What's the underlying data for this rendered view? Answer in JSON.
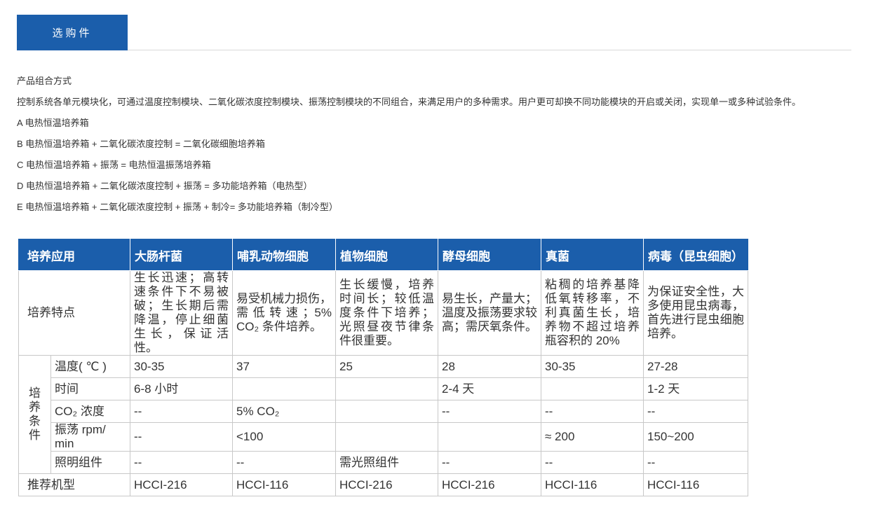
{
  "tab": {
    "label": "选购件"
  },
  "description": {
    "heading": "产品组合方式",
    "paragraph": "控制系统各单元模块化，可通过温度控制模块、二氧化碳浓度控制模块、振荡控制模块的不同组合，来满足用户的多种需求。用户更可却换不同功能模块的开启或关闭，实现单一或多种试验条件。",
    "combos": [
      "A 电热恒温培养箱",
      "B 电热恒温培养箱 + 二氧化碳浓度控制 = 二氧化碳细胞培养箱",
      "C 电热恒温培养箱 + 振荡 = 电热恒温振荡培养箱",
      "D 电热恒温培养箱 + 二氧化碳浓度控制 + 振荡 = 多功能培养箱（电热型）",
      "E 电热恒温培养箱 + 二氧化碳浓度控制 + 振荡 + 制冷= 多功能培养箱（制冷型）"
    ]
  },
  "table": {
    "headers": [
      "培养应用",
      "大肠杆菌",
      "哺乳动物细胞",
      "植物细胞",
      "酵母细胞",
      "真菌",
      "病毒（昆虫细胞）"
    ],
    "feature_label": "培养特点",
    "features": [
      "生长迅速；高转速条件下不易被破；生长期后需降温，停止细菌生长，保证活性。",
      "易受机械力损伤，需低转速；5% CO₂ 条件培养。",
      "生长缓慢，培养时间长；较低温度条件下培养；光照昼夜节律条件很重要。",
      "易生长，产量大；温度及振荡要求较高；需厌氧条件。",
      "粘稠的培养基降低氧转移率，不利真菌生长，培养物不超过培养瓶容积的 20%",
      "为保证安全性，大多使用昆虫病毒，首先进行昆虫细胞培养。"
    ],
    "conditions_label": "培养条件",
    "conditions": [
      {
        "label": "温度( ℃ )",
        "values": [
          "30-35",
          "37",
          "25",
          "28",
          "30-35",
          "27-28"
        ]
      },
      {
        "label": "时间",
        "values": [
          "6-8 小时",
          "",
          "",
          "2-4 天",
          "",
          "1-2 天"
        ]
      },
      {
        "label": "CO₂ 浓度",
        "values": [
          "--",
          "5% CO₂",
          "",
          "--",
          "--",
          "--"
        ]
      },
      {
        "label": "振荡 rpm/ min",
        "values": [
          "--",
          "<100",
          "",
          "",
          "≈ 200",
          "150~200"
        ]
      },
      {
        "label": "照明组件",
        "values": [
          "--",
          "--",
          "需光照组件",
          "--",
          "--",
          "--"
        ]
      }
    ],
    "model_label": "推荐机型",
    "models": [
      "HCCI-216",
      "HCCI-116",
      "HCCI-216",
      "HCCI-216",
      "HCCI-116",
      "HCCI-116"
    ]
  }
}
